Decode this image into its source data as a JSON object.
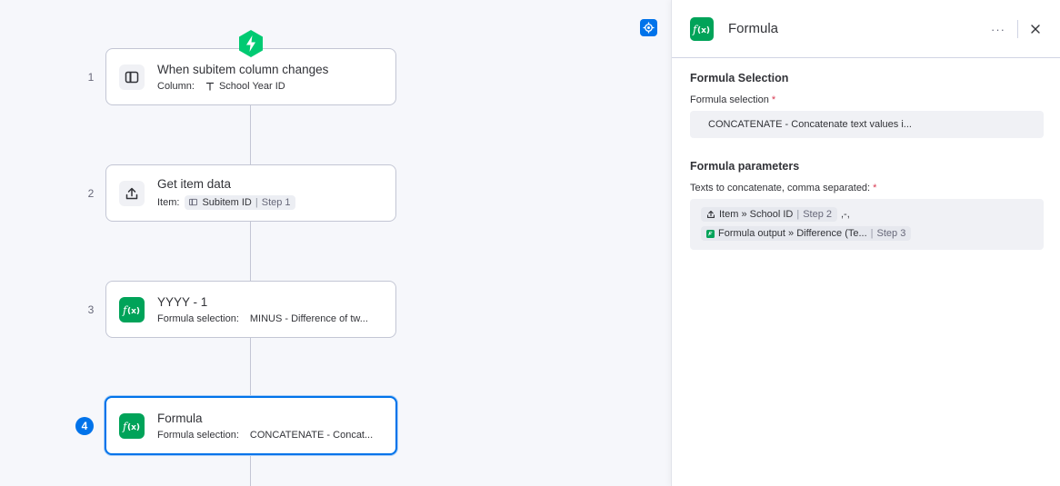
{
  "canvas": {
    "steps": [
      {
        "number": "1",
        "title": "When subitem column changes",
        "sub_label": "Column:",
        "value": "School Year ID",
        "icon": "column-icon"
      },
      {
        "number": "2",
        "title": "Get item data",
        "sub_label": "Item:",
        "chip_value": "Subitem ID",
        "chip_step": "Step 1",
        "icon": "upload-icon"
      },
      {
        "number": "3",
        "title": "YYYY - 1",
        "sub_label": "Formula selection:",
        "value": "MINUS - Difference of tw...",
        "icon": "formula-icon"
      },
      {
        "number": "4",
        "title": "Formula",
        "sub_label": "Formula selection:",
        "value": "CONCATENATE - Concat...",
        "icon": "formula-icon",
        "selected": true
      }
    ]
  },
  "panel": {
    "title": "Formula",
    "more_label": "···",
    "section1": {
      "title": "Formula Selection",
      "field_label": "Formula selection",
      "required_mark": "*",
      "selected_value": "CONCATENATE - Concatenate text values i..."
    },
    "section2": {
      "title": "Formula parameters",
      "field_label": "Texts to concatenate, comma separated:",
      "required_mark": "*",
      "params": [
        {
          "label": "Item » School ID",
          "step": "Step 2",
          "suffix": ",-,",
          "icon": "upload-icon"
        },
        {
          "label": "Formula output » Difference (Te...",
          "step": "Step 3",
          "suffix": "",
          "icon": "formula-small-icon"
        }
      ]
    }
  },
  "colors": {
    "accent": "#0073ea",
    "formula_green": "#00a359",
    "trigger_green": "#00ca72",
    "required_red": "#d83a52"
  }
}
